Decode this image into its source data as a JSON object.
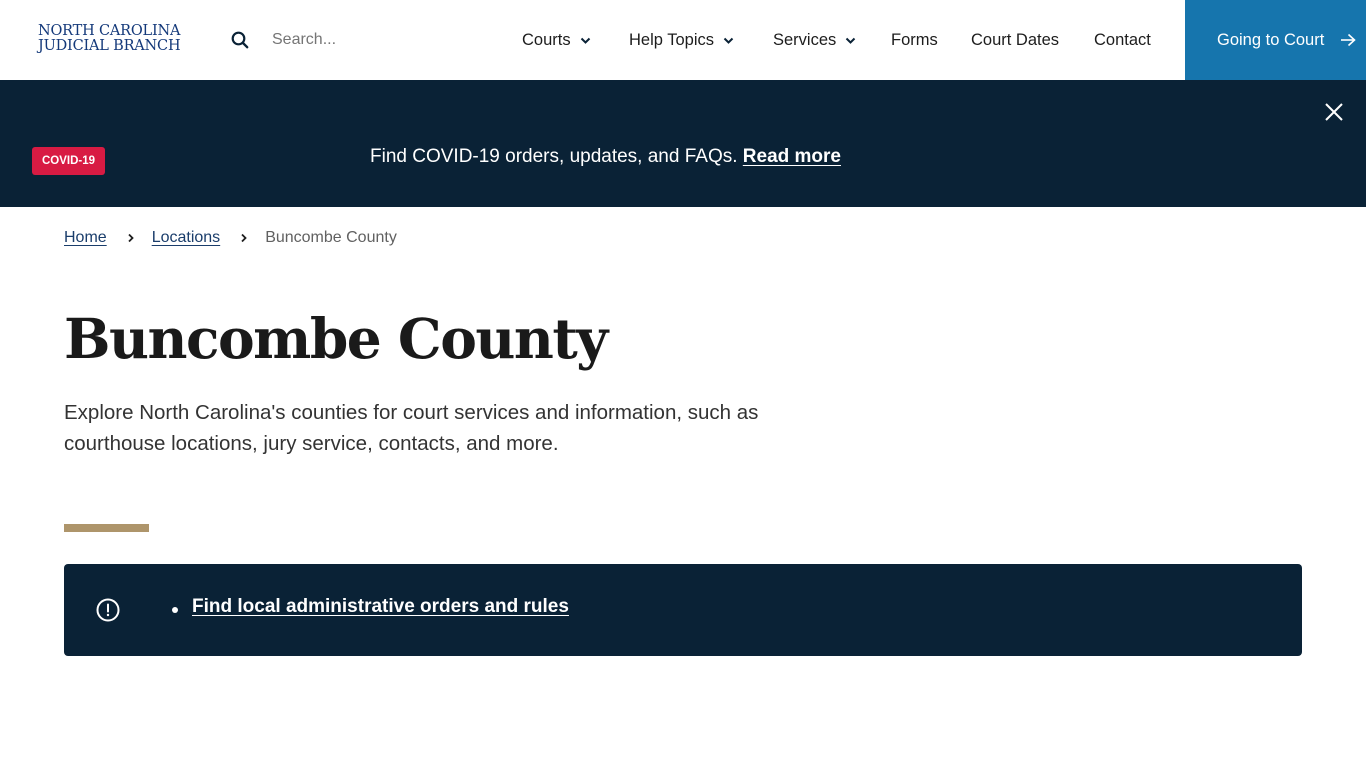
{
  "header": {
    "logo_line1": "NORTH CAROLINA",
    "logo_line2": "JUDICIAL BRANCH",
    "search_placeholder": "Search...",
    "search_value": "",
    "nav": [
      {
        "label": "Courts",
        "has_dropdown": true
      },
      {
        "label": "Help Topics",
        "has_dropdown": true
      },
      {
        "label": "Services",
        "has_dropdown": true
      },
      {
        "label": "Forms",
        "has_dropdown": false
      },
      {
        "label": "Court Dates",
        "has_dropdown": false
      },
      {
        "label": "Contact",
        "has_dropdown": false
      }
    ],
    "cta_label": "Going to Court",
    "cta_icon": "arrow-right-icon"
  },
  "banner": {
    "badge": "COVID-19",
    "message": "Find COVID-19 orders, updates, and FAQs.",
    "link_label": "Read more",
    "close_icon": "close-icon"
  },
  "breadcrumb": {
    "items": [
      {
        "label": "Home",
        "link": true
      },
      {
        "label": "Locations",
        "link": true
      },
      {
        "label": "Buncombe County",
        "link": false
      }
    ]
  },
  "page": {
    "title": "Buncombe County",
    "intro": "Explore North Carolina's counties for court services and information, such as courthouse locations, jury service, contacts, and more."
  },
  "notice": {
    "icon": "exclamation-circle-icon",
    "links": [
      {
        "label": "Find local administrative orders and rules"
      }
    ]
  },
  "colors": {
    "brand_navy": "#0a2236",
    "cta_blue": "#1675ad",
    "badge_red": "#d81b43",
    "accent_gold": "#ae956b",
    "logo_blue": "#14397a",
    "link_blue": "#1a3d6b"
  }
}
